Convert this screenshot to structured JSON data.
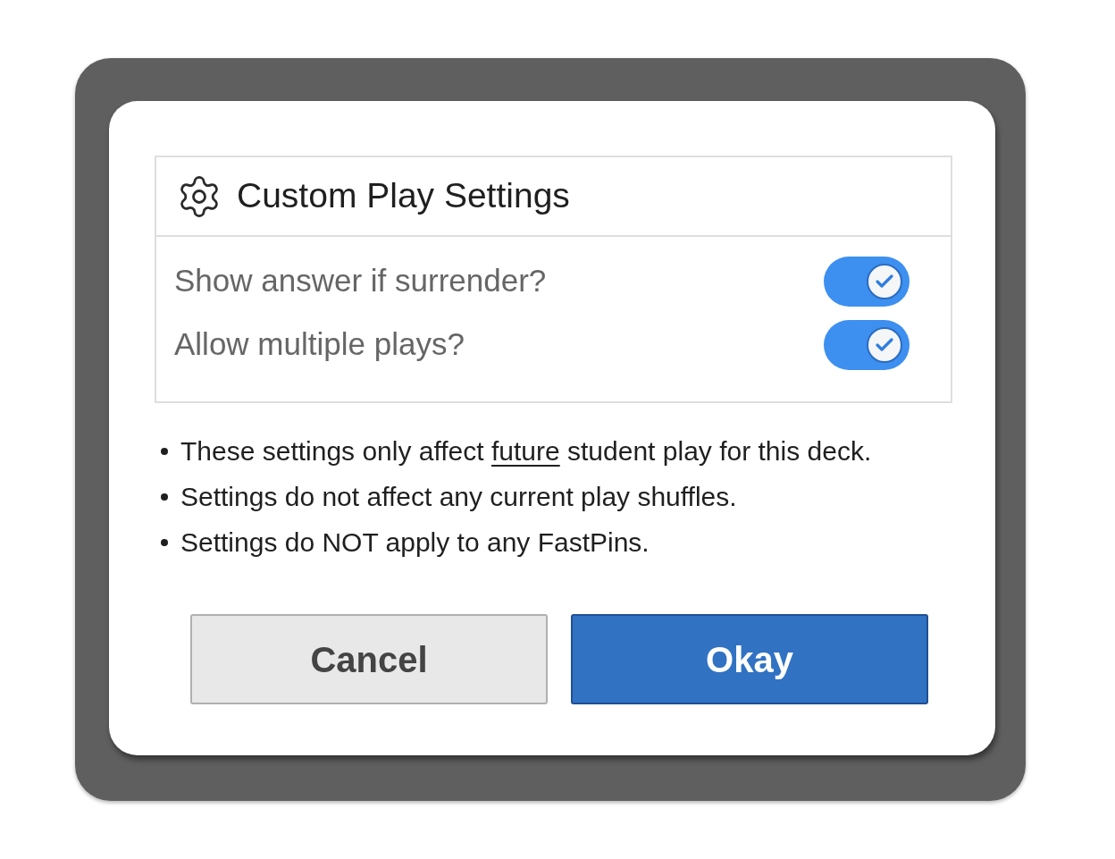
{
  "dialog": {
    "title": "Custom Play Settings"
  },
  "settings": [
    {
      "label": "Show answer if surrender?",
      "on": true
    },
    {
      "label": "Allow multiple plays?",
      "on": true
    }
  ],
  "notes": [
    {
      "parts": [
        {
          "text": "These settings only affect ",
          "kind": "plain"
        },
        {
          "text": "future",
          "kind": "underlined"
        },
        {
          "text": " student play for this deck.",
          "kind": "plain"
        }
      ]
    },
    {
      "parts": [
        {
          "text": "Settings do not affect any current play shuffles.",
          "kind": "plain"
        }
      ]
    },
    {
      "parts": [
        {
          "text": "Settings do NOT apply to any FastPins.",
          "kind": "plain"
        }
      ]
    }
  ],
  "buttons": [
    {
      "label": "Cancel",
      "kind": "secondary"
    },
    {
      "label": "Okay",
      "kind": "primary"
    }
  ]
}
